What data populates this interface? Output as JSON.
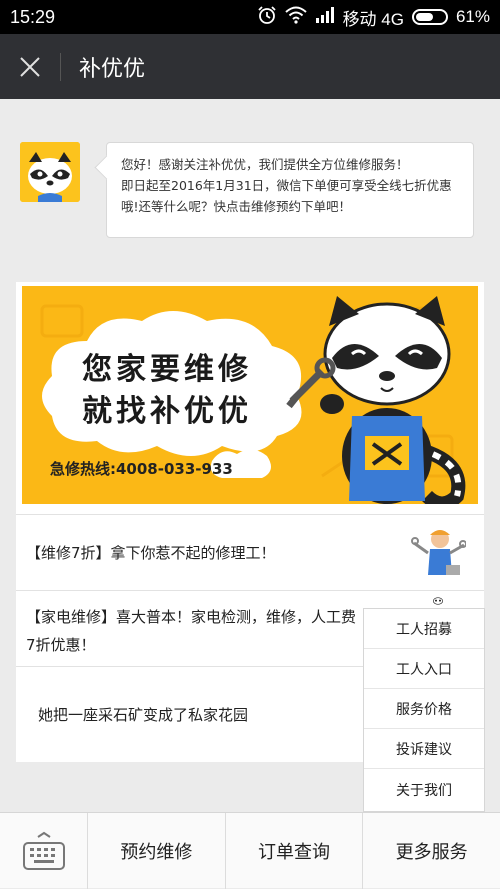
{
  "status": {
    "time": "15:29",
    "carrier": "移动 4G",
    "battery": "61%",
    "battery_level": 0.61
  },
  "header": {
    "title": "补优优",
    "close_icon": "close-icon"
  },
  "message": {
    "line1": "您好！感谢关注补优优，我们提供全方位维修服务！",
    "line2": "即日起至2016年1月31日，微信下单便可享受全线七折优惠",
    "line3": "哦!还等什么呢？快点击维修预约下单吧！"
  },
  "banner": {
    "slogan_line1": "您家要维修",
    "slogan_line2": "就找补优优",
    "hotline": "急修热线:4008-033-933"
  },
  "news": [
    {
      "title": "【维修7折】拿下你惹不起的修理工！"
    },
    {
      "title": "【家电维修】喜大普本！家电检测，维修，人工费",
      "title_cont": "7折优惠！"
    },
    {
      "title": "她把一座采石矿变成了私家花园"
    }
  ],
  "popup_menu": [
    "工人招募",
    "工人入口",
    "服务价格",
    "投诉建议",
    "关于我们"
  ],
  "bottom_menu": {
    "keyboard_icon": "keyboard-icon",
    "items": [
      "预约维修",
      "订单查询",
      "更多服务"
    ]
  },
  "colors": {
    "accent": "#fbb816",
    "header_bg": "#2f3034"
  }
}
